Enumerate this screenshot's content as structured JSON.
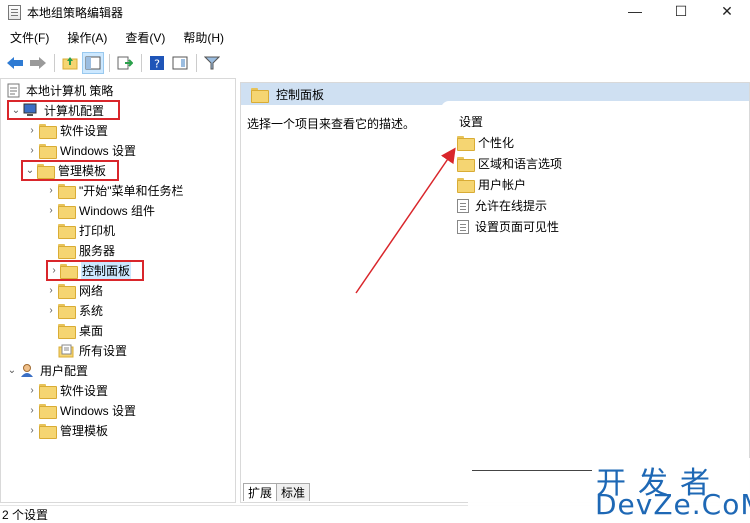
{
  "window": {
    "title": "本地组策略编辑器",
    "minimize": "—",
    "maximize": "☐",
    "close": "✕"
  },
  "menu": [
    "文件(F)",
    "操作(A)",
    "查看(V)",
    "帮助(H)"
  ],
  "tree": {
    "root": "本地计算机 策略",
    "computer_config": "计算机配置",
    "software_settings": "软件设置",
    "windows_settings": "Windows 设置",
    "admin_templates": "管理模板",
    "start_menu": "\"开始\"菜单和任务栏",
    "windows_components": "Windows 组件",
    "printers": "打印机",
    "server": "服务器",
    "control_panel": "控制面板",
    "network": "网络",
    "system": "系统",
    "desktop": "桌面",
    "all_settings": "所有设置",
    "user_config": "用户配置",
    "user_software_settings": "软件设置",
    "user_windows_settings": "Windows 设置",
    "user_admin_templates": "管理模板"
  },
  "right": {
    "header": "控制面板",
    "description": "选择一个项目来查看它的描述。",
    "column_title": "设置",
    "items": [
      {
        "label": "个性化",
        "icon": "folder-icon"
      },
      {
        "label": "区域和语言选项",
        "icon": "folder-icon"
      },
      {
        "label": "用户帐户",
        "icon": "folder-icon"
      },
      {
        "label": "允许在线提示",
        "icon": "setting-page-icon"
      },
      {
        "label": "设置页面可见性",
        "icon": "setting-page-icon"
      }
    ]
  },
  "tabs": [
    "扩展",
    "标准"
  ],
  "status": "2 个设置",
  "watermark": {
    "cn": "开发者",
    "en": "DevZe.CoM"
  },
  "colors": {
    "highlight_box": "#d9262b",
    "header_bg": "#cfe0f2",
    "selected_bg": "#cce8ff",
    "watermark": "#1e68b5"
  }
}
